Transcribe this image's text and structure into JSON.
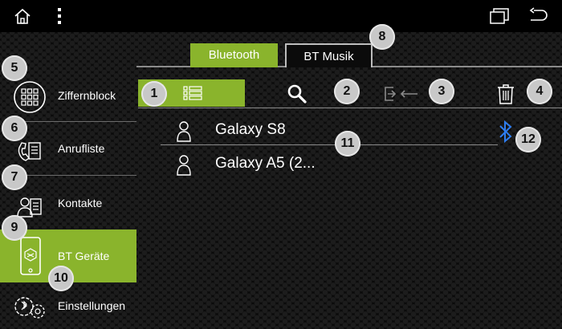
{
  "tabs": [
    {
      "label": "Bluetooth",
      "active": true
    },
    {
      "label": "BT Musik",
      "active": false
    }
  ],
  "sidebar": {
    "items": [
      {
        "label": "Ziffernblock",
        "icon": "dialpad-icon"
      },
      {
        "label": "Anrufliste",
        "icon": "call-log-icon"
      },
      {
        "label": "Kontakte",
        "icon": "contacts-icon"
      },
      {
        "label": "BT Geräte",
        "icon": "phone-device-icon",
        "active": true
      },
      {
        "label": "Einstellungen",
        "icon": "settings-icon"
      }
    ]
  },
  "toolbar": {
    "icons": [
      "list-view-icon",
      "search-icon",
      "connect-icon",
      "trash-icon"
    ]
  },
  "devices": [
    {
      "name": "Galaxy S8",
      "connected": true
    },
    {
      "name": "Galaxy A5 (2..."
    }
  ],
  "callouts": [
    "1",
    "2",
    "3",
    "4",
    "5",
    "6",
    "7",
    "8",
    "9",
    "10",
    "11",
    "12"
  ],
  "colors": {
    "accent": "#8ab42c",
    "bluetooth": "#2e7df0",
    "background": "#0b0b0b"
  }
}
